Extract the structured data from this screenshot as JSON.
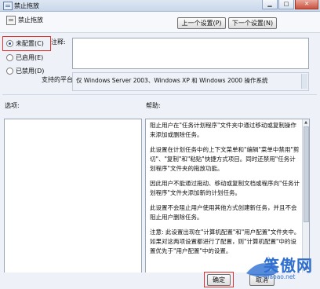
{
  "window": {
    "title": "禁止拖放"
  },
  "header": {
    "policy_name": "禁止拖放",
    "prev_button": "上一个设置(P)",
    "next_button": "下一个设置(N)"
  },
  "state": {
    "options": [
      {
        "label": "未配置(C)",
        "selected": true
      },
      {
        "label": "已启用(E)",
        "selected": false
      },
      {
        "label": "已禁用(D)",
        "selected": false
      }
    ]
  },
  "comment": {
    "label": "注释:",
    "value": ""
  },
  "platform": {
    "label": "支持的平台:",
    "value": "仅 Windows Server 2003、Windows XP 和 Windows 2000 操作系统"
  },
  "sections": {
    "options_label": "选项:",
    "help_label": "帮助:"
  },
  "help": {
    "paragraphs": [
      "阻止用户在\"任务计划程序\"文件夹中通过移动或复制操作来添加或删除任务。",
      "此设置在计划任务中的上下文菜单和\"编辑\"菜单中禁用\"剪切\"、\"复制\"和\"粘贴\"快捷方式项目。同时还禁用\"任务计划程序\"文件夹的拖放功能。",
      "因此用户不能通过拖动、移动或复制文档或程序向\"任务计划程序\"文件夹添加新的计划任务。",
      "此设置不会阻止用户使用其他方式创建新任务，并且不会阻止用户删除任务。",
      "注意: 此设置出现在\"计算机配置\"和\"用户配置\"文件夹中。如果对这两项设置都进行了配置，则\"计算机配置\"中的设置优先于\"用户配置\"中的设置。"
    ]
  },
  "footer": {
    "ok_button": "确定",
    "cancel_button": "取消"
  },
  "watermark": {
    "text": "笑傲网",
    "sub": "xiaoao.net"
  },
  "colors": {
    "highlight": "#e4322b",
    "watermark": "#2f6fd0"
  }
}
